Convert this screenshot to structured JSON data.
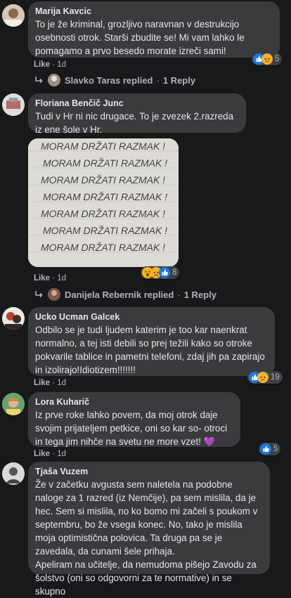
{
  "comments": [
    {
      "author": "Marija Kavcic",
      "text": "To je že kriminal, grozljivo naravnan v destrukcijo osebnosti otrok. Starši zbudite se! Mi vam lahko le pomagamo a prvo besedo morate izreči sami!",
      "like": "Like",
      "time": "1d",
      "reaction_count": "5",
      "reply_author": "Slavko Taras replied",
      "reply_count": "1 Reply"
    },
    {
      "author": "Floriana Benčič Junc",
      "text": "Tudi v Hr ni nic drugace. To je zvezek 2.razreda iz ene šole v Hr.",
      "photo_lines": [
        "MORAM DRŽATI RAZMAK !",
        "MORAM DRŽATI RAZMAK !",
        "MORAM DRŽATI RAZMAK !",
        "MORAM DRŽATI RAZMAK !",
        "MORAM DRŽATI RAZMAK !",
        "MORAM DRŽATI RAZMAK !",
        "MORAM DRŽATI RAZMAK !"
      ],
      "like": "Like",
      "time": "1d",
      "reaction_count": "8",
      "reply_author": "Danijela Rebernik replied",
      "reply_count": "1 Reply"
    },
    {
      "author": "Ucko Ucman Galcek",
      "text": "Odbilo se je tudi ljudem katerim je too kar naenkrat normalno, a tej isti debili so prej težili kako so otroke pokvarile tablice in pametni telefoni, zdaj jih pa zapirajo in izolirajo!Idiotizem!!!!!!!",
      "like": "Like",
      "time": "1d",
      "reaction_count": "19"
    },
    {
      "author": "Lora Kuharič",
      "text": "Iz prve roke lahko povem, da moj otrok daje svojim prijateljem petkice, oni so kar so- otroci in tega jim nihče na svetu ne more vzet! 💜",
      "like": "Like",
      "time": "1d",
      "reaction_count": "5"
    },
    {
      "author": "Tjaša Vuzem",
      "text": "Že v začetku avgusta sem naletela na podobne naloge za 1 razred (iz Nemčije), pa sem mislila, da je hec. Sem si mislila, no ko bomo mi začeli s poukom v septembru, bo že vsega konec. No, tako je mislila moja optimistična polovica. Ta druga pa se je zavedala, da cunami šele prihaja.",
      "text2": "Apeliram na učitelje, da nemudoma pišejo Zavodu za šolstvo (oni so odgovorni za te normative) in se skupno"
    }
  ],
  "colors": {
    "bg": "#18191a",
    "bubble": "#3a3b3c",
    "text": "#e4e6eb",
    "muted": "#b0b3b8",
    "like_blue": "#1877f2"
  }
}
